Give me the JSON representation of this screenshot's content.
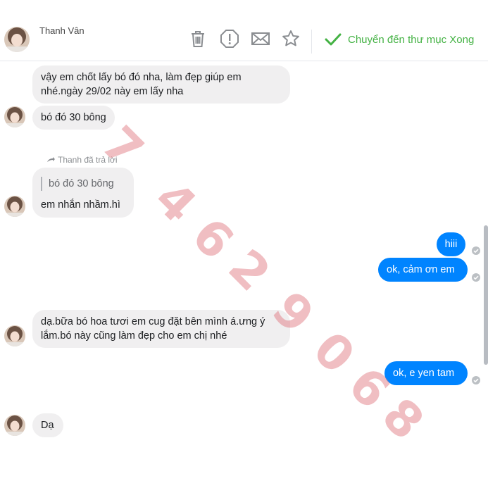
{
  "header": {
    "contact_name": "Thanh Vân",
    "move_done_label": "Chuyển đến thư mục Xong"
  },
  "messages": {
    "m1": "vậy em chốt lấy bó đó nha, làm đẹp giúp em nhé.ngày 29/02 này em lấy nha",
    "m2": "bó đó 30 bông",
    "reply_note": "Thanh đã trả lời",
    "m3_quote": "bó đó 30 bông",
    "m3": "em nhắn nhầm.hì",
    "out1": "hiii",
    "out2": "ok, cảm ơn em",
    "m4": "dạ.bữa bó hoa tươi em cug đặt bên mình á.ưng ý lắm.bó này cũng làm đẹp cho em chị nhé",
    "out3": "ok, e yen tam",
    "m5": "Dạ"
  },
  "watermark": {
    "chars": [
      "7",
      "4",
      "6",
      "2",
      "9",
      "0",
      "6",
      "8"
    ]
  },
  "colors": {
    "outgoing_bubble": "#0084ff",
    "incoming_bubble": "#f0eff0",
    "done_green": "#44b244",
    "watermark": "#de6e78"
  },
  "icons": {
    "trash": "trash-icon",
    "report": "exclamation-icon",
    "mail": "envelope-icon",
    "star": "star-icon",
    "check": "check-icon"
  }
}
